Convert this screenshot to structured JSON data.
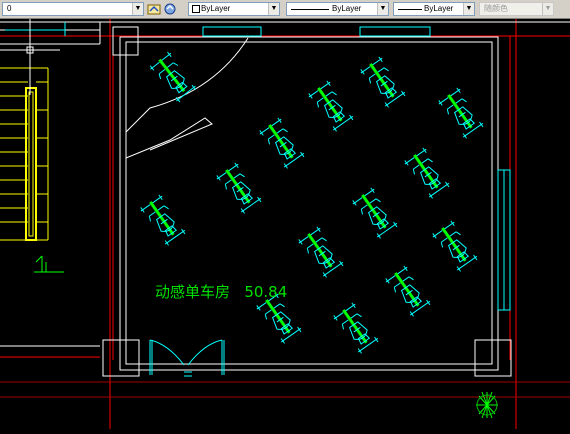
{
  "toolbar": {
    "layer": {
      "value": "0"
    },
    "color": {
      "value": "ByLayer"
    },
    "linetype": {
      "value": "ByLayer"
    },
    "lineweight": {
      "value": "ByLayer"
    },
    "plotstyle": {
      "value": "随颜色"
    }
  },
  "drawing": {
    "room_name": "动感单车房",
    "room_area": "50.84",
    "colors": {
      "background": "#000000",
      "walls": "#ffffff",
      "bikes": "#00ffff",
      "bike_frame": "#00ff00",
      "stairs": "#ffff00",
      "axis": "#ff0000",
      "label": "#00e000"
    },
    "bike_count": 14
  }
}
